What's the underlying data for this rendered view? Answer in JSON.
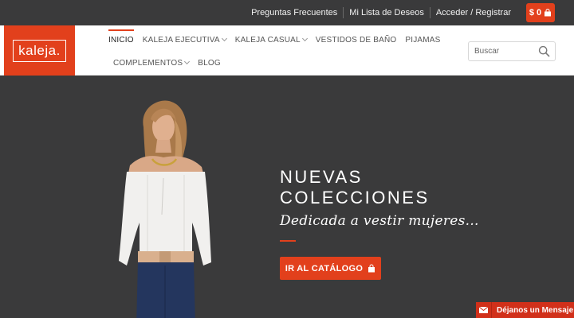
{
  "topbar": {
    "links": [
      "Preguntas Frecuentes",
      "Mi Lista de Deseos",
      "Acceder / Registrar"
    ],
    "cart_label": "$ 0"
  },
  "logo": {
    "text": "kaleja."
  },
  "nav": {
    "row1": [
      {
        "label": "INICIO",
        "active": true,
        "dropdown": false
      },
      {
        "label": "KALEJA EJECUTIVA",
        "active": false,
        "dropdown": true
      },
      {
        "label": "KALEJA CASUAL",
        "active": false,
        "dropdown": true
      },
      {
        "label": "VESTIDOS DE BAÑO",
        "active": false,
        "dropdown": false
      },
      {
        "label": "PIJAMAS",
        "active": false,
        "dropdown": false
      }
    ],
    "row2": [
      {
        "label": "COMPLEMENTOS",
        "active": false,
        "dropdown": true
      },
      {
        "label": "BLOG",
        "active": false,
        "dropdown": false
      }
    ]
  },
  "search": {
    "placeholder": "Buscar",
    "value": ""
  },
  "hero": {
    "title_line1": "NUEVAS",
    "title_line2": "COLECCIONES",
    "subtitle": "Dedicada a vestir mujeres...",
    "cta_label": "IR AL CATÁLOGO"
  },
  "message_tab": {
    "label": "Déjanos un Mensaje"
  },
  "colors": {
    "accent": "#e2401c",
    "topbar": "#3a3a3b",
    "hero_bg": "#3a3a3b"
  }
}
